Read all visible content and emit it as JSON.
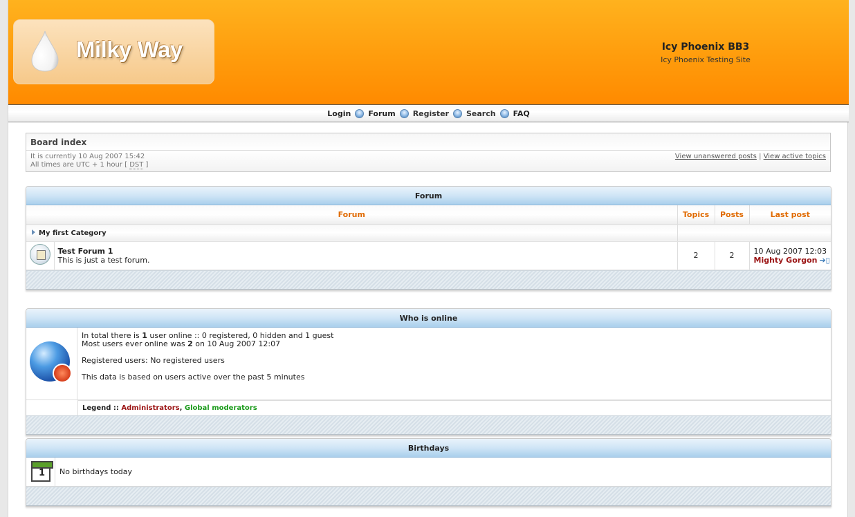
{
  "header": {
    "logo_text": "Milky Way",
    "site_title": "Icy Phoenix BB3",
    "site_desc": "Icy Phoenix Testing Site"
  },
  "nav": {
    "login": "Login",
    "forum": "Forum",
    "register": "Register",
    "search": "Search",
    "faq": "FAQ"
  },
  "board": {
    "title": "Board index",
    "current_time": "It is currently 10 Aug 2007 15:42",
    "timezone_prefix": "All times are UTC + 1 hour [",
    "dst": "DST",
    "timezone_suffix": "]",
    "unanswered": "View unanswered posts",
    "link_sep": "|",
    "active": "View active topics"
  },
  "forum_panel": {
    "title": "Forum",
    "col_forum": "Forum",
    "col_topics": "Topics",
    "col_posts": "Posts",
    "col_lastpost": "Last post",
    "category": "My first Category",
    "forums": [
      {
        "name": "Test Forum 1",
        "desc": "This is just a test forum.",
        "topics": "2",
        "posts": "2",
        "last_date": "10 Aug 2007 12:03",
        "last_author": "Mighty Gorgon"
      }
    ]
  },
  "online": {
    "title": "Who is online",
    "line1_a": "In total there is ",
    "line1_count": "1",
    "line1_b": " user online :: 0 registered, 0 hidden and 1 guest",
    "line2_a": "Most users ever online was ",
    "line2_count": "2",
    "line2_b": " on 10 Aug 2007 12:07",
    "registered": "Registered users: No registered users",
    "based": "This data is based on users active over the past 5 minutes",
    "legend_label": "Legend ::",
    "legend_admin": "Administrators",
    "legend_sep": ",",
    "legend_mod": "Global moderators"
  },
  "birthdays": {
    "title": "Birthdays",
    "calendar_day": "1",
    "text": "No birthdays today"
  },
  "colors": {
    "header_orange": "#ff9c0c",
    "accent_orange": "#e06a00",
    "author_red": "#9b1414",
    "mod_green": "#1a9a1a",
    "panel_blue": "#a9cfec"
  }
}
